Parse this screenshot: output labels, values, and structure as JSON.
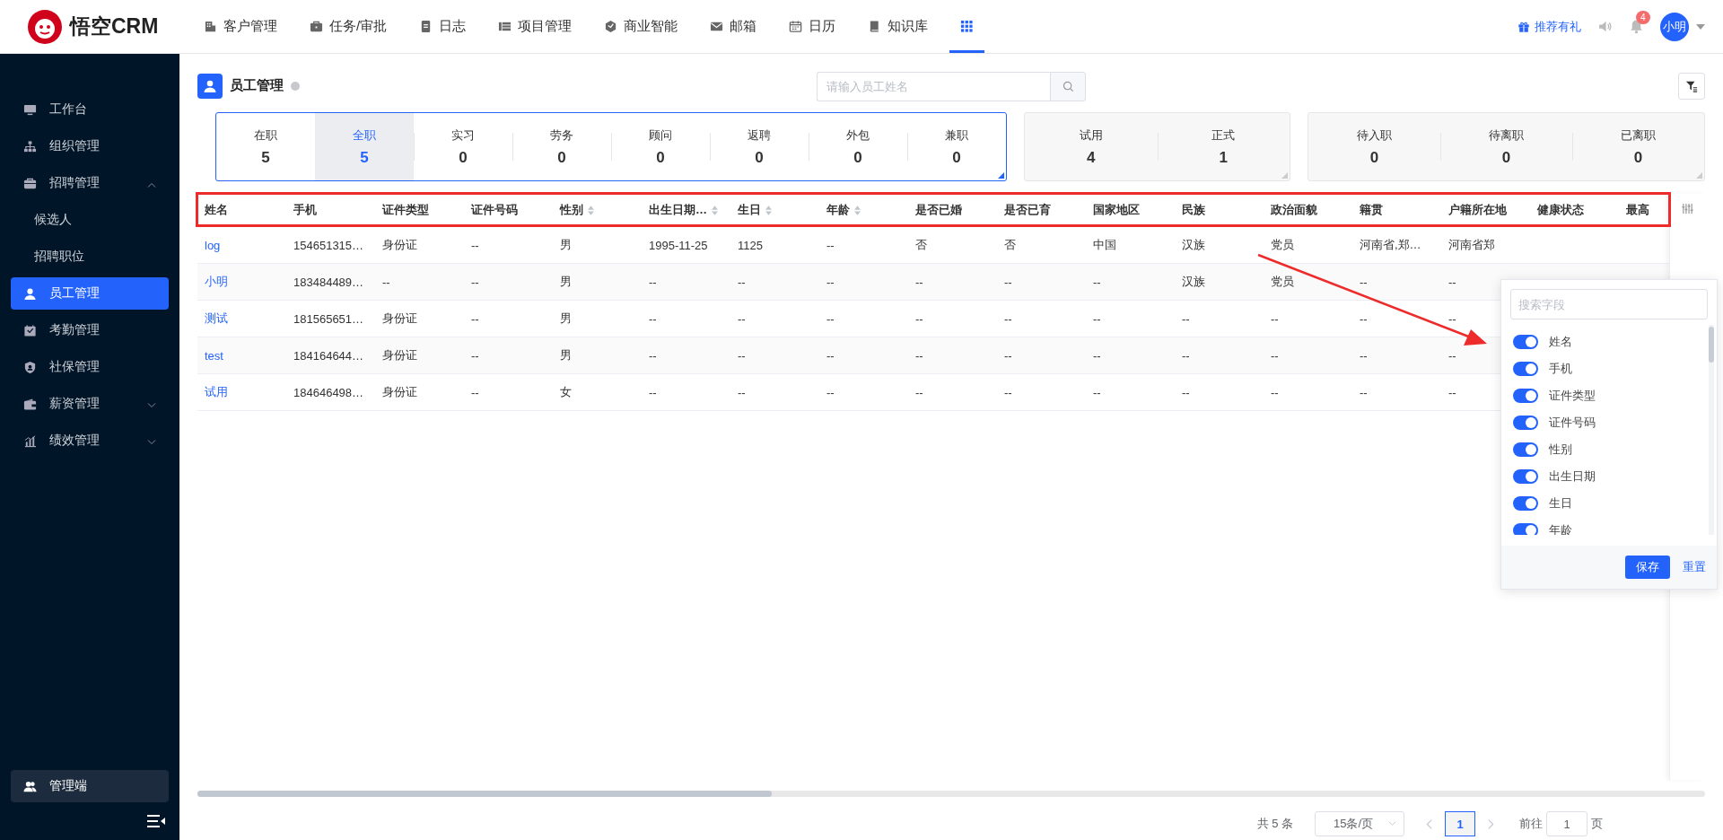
{
  "topbar": {
    "logo_text": "悟空CRM",
    "nav": [
      {
        "label": "客户管理",
        "selected": false
      },
      {
        "label": "任务/审批",
        "selected": false
      },
      {
        "label": "日志",
        "selected": false
      },
      {
        "label": "项目管理",
        "selected": false
      },
      {
        "label": "商业智能",
        "selected": false
      },
      {
        "label": "邮箱",
        "selected": false
      },
      {
        "label": "日历",
        "selected": false
      },
      {
        "label": "知识库",
        "selected": false
      }
    ],
    "apps_menu": {
      "selected": true
    },
    "promo": "推荐有礼",
    "notification_count": "4",
    "user": "小明"
  },
  "sidebar": {
    "items": [
      {
        "label": "工作台",
        "kind": "link",
        "selected": false
      },
      {
        "label": "组织管理",
        "kind": "link",
        "selected": false
      },
      {
        "label": "招聘管理",
        "kind": "group",
        "selected": false,
        "expanded": true,
        "children": [
          {
            "label": "候选人",
            "kind": "link",
            "selected": false
          },
          {
            "label": "招聘职位",
            "kind": "link",
            "selected": false
          }
        ]
      },
      {
        "label": "员工管理",
        "kind": "link",
        "selected": true
      },
      {
        "label": "考勤管理",
        "kind": "link",
        "selected": false
      },
      {
        "label": "社保管理",
        "kind": "link",
        "selected": false
      },
      {
        "label": "薪资管理",
        "kind": "group",
        "selected": false,
        "expanded": false
      },
      {
        "label": "绩效管理",
        "kind": "group",
        "selected": false,
        "expanded": false
      }
    ],
    "admin": "管理端"
  },
  "page": {
    "title": "员工管理",
    "search_placeholder": "请输入员工姓名"
  },
  "stat_groups": [
    {
      "selected": true,
      "cells": [
        {
          "label": "在职",
          "value": "5",
          "selected": false
        },
        {
          "label": "全职",
          "value": "5",
          "selected": true
        },
        {
          "label": "实习",
          "value": "0",
          "selected": false
        },
        {
          "label": "劳务",
          "value": "0",
          "selected": false
        },
        {
          "label": "顾问",
          "value": "0",
          "selected": false
        },
        {
          "label": "返聘",
          "value": "0",
          "selected": false
        },
        {
          "label": "外包",
          "value": "0",
          "selected": false
        },
        {
          "label": "兼职",
          "value": "0",
          "selected": false
        }
      ]
    },
    {
      "selected": false,
      "cells": [
        {
          "label": "试用",
          "value": "4",
          "selected": false
        },
        {
          "label": "正式",
          "value": "1",
          "selected": false
        }
      ]
    },
    {
      "selected": false,
      "cells": [
        {
          "label": "待入职",
          "value": "0",
          "selected": false
        },
        {
          "label": "待离职",
          "value": "0",
          "selected": false
        },
        {
          "label": "已离职",
          "value": "0",
          "selected": false
        }
      ]
    }
  ],
  "table": {
    "columns": [
      {
        "label": "姓名",
        "sortable": false
      },
      {
        "label": "手机",
        "sortable": false
      },
      {
        "label": "证件类型",
        "sortable": false
      },
      {
        "label": "证件号码",
        "sortable": false
      },
      {
        "label": "性别",
        "sortable": true
      },
      {
        "label": "出生日期…",
        "sortable": true
      },
      {
        "label": "生日",
        "sortable": true
      },
      {
        "label": "年龄",
        "sortable": true
      },
      {
        "label": "是否已婚",
        "sortable": false
      },
      {
        "label": "是否已育",
        "sortable": false
      },
      {
        "label": "国家地区",
        "sortable": false
      },
      {
        "label": "民族",
        "sortable": false
      },
      {
        "label": "政治面貌",
        "sortable": false
      },
      {
        "label": "籍贯",
        "sortable": false
      },
      {
        "label": "户籍所在地",
        "sortable": false
      },
      {
        "label": "健康状态",
        "sortable": false
      },
      {
        "label": "最高",
        "sortable": false
      }
    ],
    "rows": [
      [
        "log",
        "154651315…",
        "身份证",
        "--",
        "男",
        "1995-11-25",
        "1125",
        "--",
        "否",
        "否",
        "中国",
        "汉族",
        "党员",
        "河南省,郑…",
        "河南省郑"
      ],
      [
        "小明",
        "183484489…",
        "--",
        "--",
        "男",
        "--",
        "--",
        "--",
        "--",
        "--",
        "--",
        "汉族",
        "党员",
        "--",
        "--"
      ],
      [
        "测试",
        "181565651…",
        "身份证",
        "--",
        "男",
        "--",
        "--",
        "--",
        "--",
        "--",
        "--",
        "--",
        "--",
        "--",
        "--"
      ],
      [
        "test",
        "184164644…",
        "身份证",
        "--",
        "男",
        "--",
        "--",
        "--",
        "--",
        "--",
        "--",
        "--",
        "--",
        "--",
        "--"
      ],
      [
        "试用",
        "184646498…",
        "身份证",
        "--",
        "女",
        "--",
        "--",
        "--",
        "--",
        "--",
        "--",
        "--",
        "--",
        "--",
        "--"
      ]
    ]
  },
  "column_picker": {
    "placeholder": "搜索字段",
    "fields": [
      {
        "label": "姓名",
        "on": true
      },
      {
        "label": "手机",
        "on": true
      },
      {
        "label": "证件类型",
        "on": true
      },
      {
        "label": "证件号码",
        "on": true
      },
      {
        "label": "性别",
        "on": true
      },
      {
        "label": "出生日期",
        "on": true
      },
      {
        "label": "生日",
        "on": true
      },
      {
        "label": "年龄",
        "on": true
      }
    ],
    "save": "保存",
    "reset": "重置"
  },
  "pagination": {
    "total": "共 5 条",
    "page_size": "15条/页",
    "pages": [
      {
        "label": "1",
        "selected": true
      }
    ],
    "goto_label": "前往",
    "goto_value": "1",
    "goto_suffix": "页"
  }
}
